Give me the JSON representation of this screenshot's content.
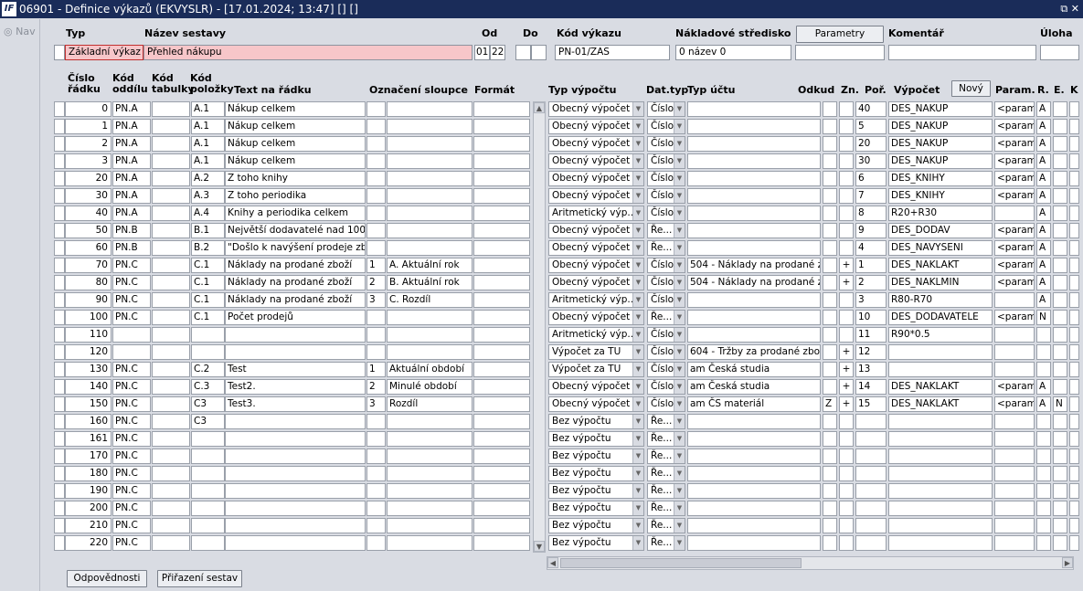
{
  "window": {
    "title": "06901 - Definice výkazů (EKVYSLR) - [17.01.2024; 13:47]  []  []",
    "logo": "IF",
    "controls": "⧉ ✕"
  },
  "nav": {
    "label": "Nav"
  },
  "header": {
    "typ_label": "Typ",
    "typ_value": "Základní výkaz",
    "nazev_label": "Název sestavy",
    "nazev_value": "Přehled nákupu",
    "od_label": "Od",
    "od_value1": "01",
    "od_value2": "22",
    "do_label": "Do",
    "kod_label": "Kód výkazu",
    "kod_value": "PN-01/ZAS",
    "stredisko_label": "Nákladové středisko",
    "stredisko_value": "0 název 0",
    "parametry_label": "Parametry",
    "komentar_label": "Komentář",
    "uloha_label": "Úloha"
  },
  "columns": {
    "cislo1": "Číslo",
    "cislo2": "řádku",
    "oddil1": "Kód",
    "oddil2": "oddílu",
    "tabulky1": "Kód",
    "tabulky2": "tabulky",
    "polozky1": "Kód",
    "polozky2": "položky",
    "text": "Text na řádku",
    "oznaceni": "Označení sloupce",
    "format": "Formát",
    "typvypoctu": "Typ výpočtu",
    "dattyp": "Dat.typ",
    "typuctu": "Typ účtu",
    "odkud": "Odkud",
    "zn": "Zn.",
    "por": "Poř.",
    "vypocet": "Výpočet",
    "novy": "Nový",
    "param": "Param.",
    "r": "R.",
    "e": "E.",
    "k": "K"
  },
  "rows": [
    {
      "cislo": "0",
      "oddil": "PN.A",
      "polozka": "A.1",
      "text": "Nákup celkem",
      "oz1": "",
      "oz2": "",
      "typv": "Obecný výpočet",
      "dat": "Číslo",
      "ucet": "",
      "odkud": "",
      "zn": "",
      "por": "40",
      "vyp": "DES_NAKUP",
      "param": "<param>",
      "r": "A",
      "e": "",
      "vypPink": true,
      "sel": true
    },
    {
      "cislo": "1",
      "oddil": "PN.A",
      "polozka": "A.1",
      "text": "Nákup celkem",
      "oz1": "",
      "oz2": "",
      "typv": "Obecný výpočet",
      "dat": "Číslo",
      "ucet": "",
      "odkud": "",
      "zn": "",
      "por": "5",
      "vyp": "DES_NAKUP",
      "param": "<param>",
      "r": "A",
      "e": "",
      "vypPink": true
    },
    {
      "cislo": "2",
      "oddil": "PN.A",
      "polozka": "A.1",
      "text": "Nákup celkem",
      "oz1": "",
      "oz2": "",
      "typv": "Obecný výpočet",
      "dat": "Číslo",
      "ucet": "",
      "odkud": "",
      "zn": "",
      "por": "20",
      "vyp": "DES_NAKUP",
      "param": "<param>",
      "r": "A",
      "e": "",
      "vypPink": true
    },
    {
      "cislo": "3",
      "oddil": "PN.A",
      "polozka": "A.1",
      "text": "Nákup celkem",
      "oz1": "",
      "oz2": "",
      "typv": "Obecný výpočet",
      "dat": "Číslo",
      "ucet": "",
      "odkud": "",
      "zn": "",
      "por": "30",
      "vyp": "DES_NAKUP",
      "param": "<param>",
      "r": "A",
      "e": "",
      "vypPink": true
    },
    {
      "cislo": "20",
      "oddil": "PN.A",
      "polozka": "A.2",
      "text": "Z toho knihy",
      "oz1": "",
      "oz2": "",
      "typv": "Obecný výpočet",
      "dat": "Číslo",
      "ucet": "",
      "odkud": "",
      "zn": "",
      "por": "6",
      "vyp": "DES_KNIHY",
      "param": "<param>",
      "r": "A",
      "e": "",
      "vypPink": true
    },
    {
      "cislo": "30",
      "oddil": "PN.A",
      "polozka": "A.3",
      "text": "Z toho periodika",
      "oz1": "",
      "oz2": "",
      "typv": "Obecný výpočet",
      "dat": "Číslo",
      "ucet": "",
      "odkud": "",
      "zn": "",
      "por": "7",
      "vyp": "DES_KNIHY",
      "param": "<param>",
      "r": "A",
      "e": "",
      "vypPink": true
    },
    {
      "cislo": "40",
      "oddil": "PN.A",
      "polozka": "A.4",
      "text": "Knihy a periodika celkem",
      "oz1": "",
      "oz2": "",
      "typv": "Aritmetický výp...",
      "dat": "Číslo",
      "ucet": "",
      "odkud": "",
      "zn": "",
      "por": "8",
      "vyp": "R20+R30",
      "param": "",
      "r": "A",
      "e": "",
      "vypPink": false
    },
    {
      "cislo": "50",
      "oddil": "PN.B",
      "polozka": "B.1",
      "text": "Největší dodavatelé nad 100 tis",
      "oz1": "",
      "oz2": "",
      "typv": "Obecný výpočet",
      "dat": "Ře...",
      "ucet": "",
      "odkud": "",
      "zn": "",
      "por": "9",
      "vyp": "DES_DODAV",
      "param": "<param>",
      "r": "A",
      "e": "",
      "vypPink": true
    },
    {
      "cislo": "60",
      "oddil": "PN.B",
      "polozka": "B.2",
      "text": "\"Došlo k navýšení prodeje zbož",
      "oz1": "",
      "oz2": "",
      "typv": "Obecný výpočet",
      "dat": "Ře...",
      "ucet": "",
      "odkud": "",
      "zn": "",
      "por": "4",
      "vyp": "DES_NAVYSENI",
      "param": "<param>",
      "r": "A",
      "e": "",
      "vypPink": true
    },
    {
      "cislo": "70",
      "oddil": "PN.C",
      "polozka": "C.1",
      "text": "Náklady na prodané zboží",
      "oz1": "1",
      "oz2": "A. Aktuální rok",
      "typv": "Obecný výpočet",
      "dat": "Číslo",
      "ucet": "504 - Náklady na prodané zbo",
      "odkud": "",
      "zn": "+",
      "por": "1",
      "vyp": "DES_NAKLAKT",
      "param": "<param>",
      "r": "A",
      "e": "",
      "vypPink": true
    },
    {
      "cislo": "80",
      "oddil": "PN.C",
      "polozka": "C.1",
      "text": "Náklady na prodané zboží",
      "oz1": "2",
      "oz2": "B. Aktuální rok",
      "typv": "Obecný výpočet",
      "dat": "Číslo",
      "ucet": "504 - Náklady na prodané zbo",
      "odkud": "",
      "zn": "+",
      "por": "2",
      "vyp": "DES_NAKLMIN",
      "param": "<param>",
      "r": "A",
      "e": "",
      "vypPink": true
    },
    {
      "cislo": "90",
      "oddil": "PN.C",
      "polozka": "C.1",
      "text": "Náklady na prodané zboží",
      "oz1": "3",
      "oz2": "C. Rozdíl",
      "typv": "Aritmetický výp...",
      "dat": "Číslo",
      "ucet": "",
      "odkud": "",
      "zn": "",
      "por": "3",
      "vyp": "R80-R70",
      "param": "",
      "r": "A",
      "e": "",
      "vypPink": false
    },
    {
      "cislo": "100",
      "oddil": "PN.C",
      "polozka": "C.1",
      "text": "Počet prodejů",
      "oz1": "",
      "oz2": "",
      "typv": "Obecný výpočet",
      "dat": "Ře...",
      "ucet": "",
      "odkud": "",
      "zn": "",
      "por": "10",
      "vyp": "DES_DODAVATELE",
      "param": "<param>",
      "r": "N",
      "e": "",
      "vypPink": true
    },
    {
      "cislo": "110",
      "oddil": "",
      "polozka": "",
      "text": "",
      "oz1": "",
      "oz2": "",
      "typv": "Aritmetický výp...",
      "dat": "Číslo",
      "ucet": "",
      "odkud": "",
      "zn": "",
      "por": "11",
      "vyp": "R90*0.5",
      "param": "",
      "r": "",
      "e": "",
      "vypPink": false
    },
    {
      "cislo": "120",
      "oddil": "",
      "polozka": "",
      "text": "",
      "oz1": "",
      "oz2": "",
      "typv": "Výpočet za TU",
      "dat": "Číslo",
      "ucet": "604 - Tržby za prodané zbož",
      "odkud": "",
      "zn": "+",
      "por": "12",
      "vyp": "",
      "param": "",
      "r": "",
      "e": "",
      "vypPink": false,
      "ucetPink": true
    },
    {
      "cislo": "130",
      "oddil": "PN.C",
      "polozka": "C.2",
      "text": "Test",
      "oz1": "1",
      "oz2": "Aktuální období",
      "typv": "Výpočet za TU",
      "dat": "Číslo",
      "ucet": "am Česká studia",
      "odkud": "",
      "zn": "+",
      "por": "13",
      "vyp": "",
      "param": "",
      "r": "",
      "e": "",
      "vypPink": false,
      "ucetPink": true
    },
    {
      "cislo": "140",
      "oddil": "PN.C",
      "polozka": "C.3",
      "text": "Test2.",
      "oz1": "2",
      "oz2": "Minulé období",
      "typv": "Obecný výpočet",
      "dat": "Číslo",
      "ucet": "am Česká studia",
      "odkud": "",
      "zn": "+",
      "por": "14",
      "vyp": "DES_NAKLAKT",
      "param": "<param>",
      "r": "A",
      "e": "",
      "vypPink": true
    },
    {
      "cislo": "150",
      "oddil": "PN.C",
      "polozka": "C3",
      "text": "Test3.",
      "oz1": "3",
      "oz2": "Rozdíl",
      "typv": "Obecný výpočet",
      "dat": "Číslo",
      "ucet": "am ČS materiál",
      "odkud": "Z",
      "zn": "+",
      "por": "15",
      "vyp": "DES_NAKLAKT",
      "param": "<param>",
      "r": "A",
      "e": "N",
      "vypPink": true
    },
    {
      "cislo": "160",
      "oddil": "PN.C",
      "polozka": "C3",
      "text": "",
      "oz1": "",
      "oz2": "",
      "typv": "Bez výpočtu",
      "dat": "Ře...",
      "ucet": "",
      "odkud": "",
      "zn": "",
      "por": "",
      "vyp": "",
      "param": "",
      "r": "",
      "e": "",
      "vypPink": false
    },
    {
      "cislo": "161",
      "oddil": "PN.C",
      "polozka": "",
      "text": "",
      "oz1": "",
      "oz2": "",
      "typv": "Bez výpočtu",
      "dat": "Ře...",
      "ucet": "",
      "odkud": "",
      "zn": "",
      "por": "",
      "vyp": "",
      "param": "",
      "r": "",
      "e": "",
      "vypPink": false
    },
    {
      "cislo": "170",
      "oddil": "PN.C",
      "polozka": "",
      "text": "",
      "oz1": "",
      "oz2": "",
      "typv": "Bez výpočtu",
      "dat": "Ře...",
      "ucet": "",
      "odkud": "",
      "zn": "",
      "por": "",
      "vyp": "",
      "param": "",
      "r": "",
      "e": "",
      "vypPink": false
    },
    {
      "cislo": "180",
      "oddil": "PN.C",
      "polozka": "",
      "text": "",
      "oz1": "",
      "oz2": "",
      "typv": "Bez výpočtu",
      "dat": "Ře...",
      "ucet": "",
      "odkud": "",
      "zn": "",
      "por": "",
      "vyp": "",
      "param": "",
      "r": "",
      "e": "",
      "vypPink": false
    },
    {
      "cislo": "190",
      "oddil": "PN.C",
      "polozka": "",
      "text": "",
      "oz1": "",
      "oz2": "",
      "typv": "Bez výpočtu",
      "dat": "Ře...",
      "ucet": "",
      "odkud": "",
      "zn": "",
      "por": "",
      "vyp": "",
      "param": "",
      "r": "",
      "e": "",
      "vypPink": false
    },
    {
      "cislo": "200",
      "oddil": "PN.C",
      "polozka": "",
      "text": "",
      "oz1": "",
      "oz2": "",
      "typv": "Bez výpočtu",
      "dat": "Ře...",
      "ucet": "",
      "odkud": "",
      "zn": "",
      "por": "",
      "vyp": "",
      "param": "",
      "r": "",
      "e": "",
      "vypPink": false
    },
    {
      "cislo": "210",
      "oddil": "PN.C",
      "polozka": "",
      "text": "",
      "oz1": "",
      "oz2": "",
      "typv": "Bez výpočtu",
      "dat": "Ře...",
      "ucet": "",
      "odkud": "",
      "zn": "",
      "por": "",
      "vyp": "",
      "param": "",
      "r": "",
      "e": "",
      "vypPink": false
    },
    {
      "cislo": "220",
      "oddil": "PN.C",
      "polozka": "",
      "text": "",
      "oz1": "",
      "oz2": "",
      "typv": "Bez výpočtu",
      "dat": "Ře...",
      "ucet": "",
      "odkud": "",
      "zn": "",
      "por": "",
      "vyp": "",
      "param": "",
      "r": "",
      "e": "",
      "vypPink": false
    }
  ],
  "buttons": {
    "odpovednosti": "Odpovědnosti",
    "prirazeni": "Přiřazení sestav"
  },
  "colors": {
    "title_bg": "#1a2c59",
    "pink": "#f7c6c9",
    "selected": "#c2d8f0",
    "window_bg": "#d9dce3"
  }
}
